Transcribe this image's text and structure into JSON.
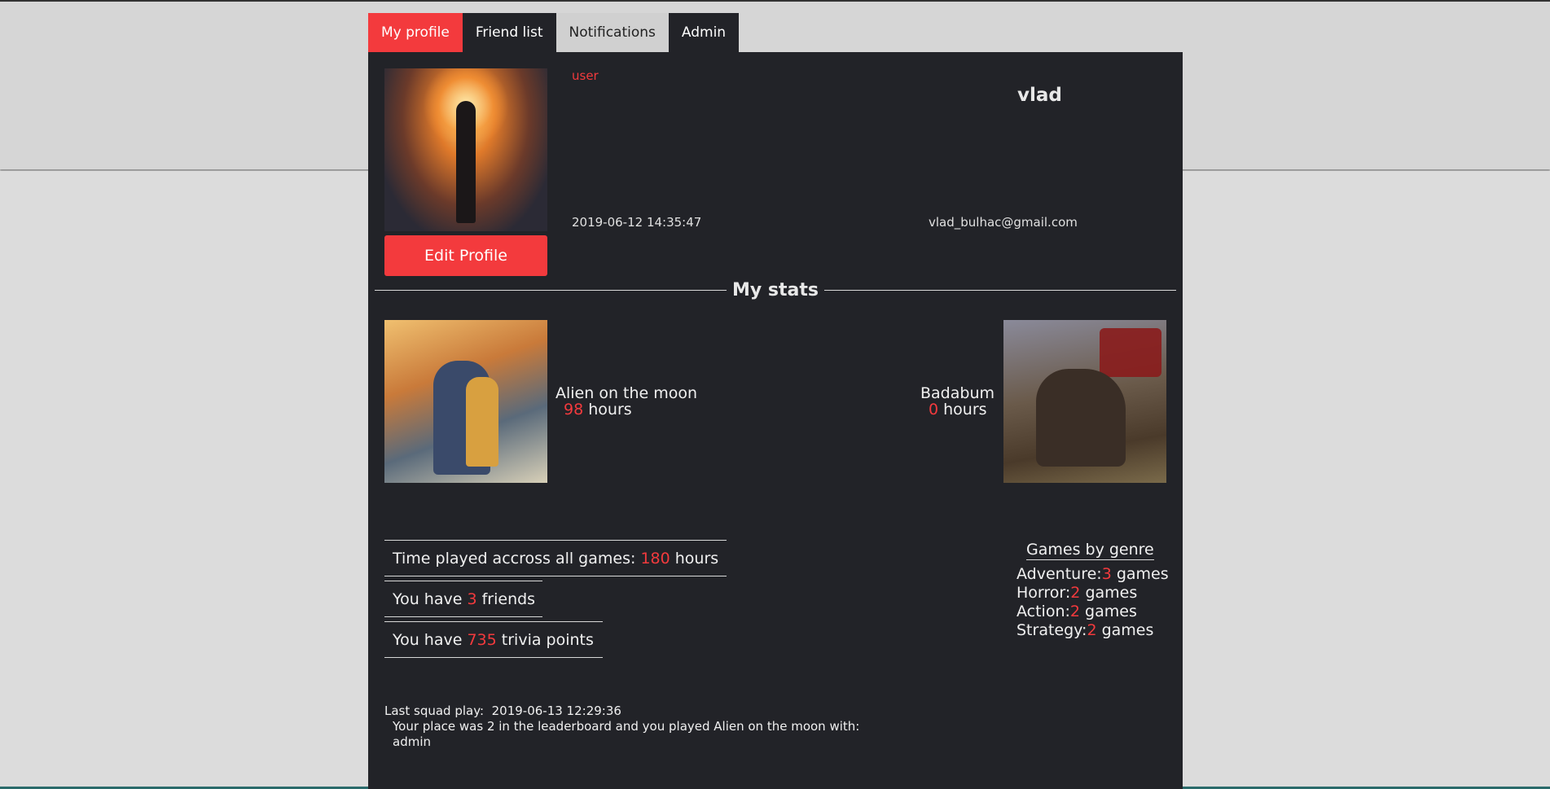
{
  "tabs": [
    {
      "label": "My profile"
    },
    {
      "label": "Friend list"
    },
    {
      "label": "Notifications"
    },
    {
      "label": "Admin"
    }
  ],
  "profile": {
    "role": "user",
    "username": "vlad",
    "joined": "2019-06-12 14:35:47",
    "email": "vlad_bulhac@gmail.com",
    "edit_button": "Edit Profile"
  },
  "stats": {
    "title": "My stats",
    "games": [
      {
        "name": "Alien on the moon",
        "hours": "98",
        "hours_label": "hours"
      },
      {
        "name": "Badabum",
        "hours": "0",
        "hours_label": "hours"
      }
    ],
    "time_played": {
      "prefix": "Time played accross all games:",
      "value": "180",
      "suffix": "hours"
    },
    "friends": {
      "prefix": "You have",
      "value": "3",
      "suffix": "friends"
    },
    "trivia": {
      "prefix": "You have",
      "value": "735",
      "suffix": "trivia points"
    },
    "genres": {
      "title": "Games by genre",
      "items": [
        {
          "name": "Adventure:",
          "count": "3",
          "unit": "games"
        },
        {
          "name": "Horror:",
          "count": "2",
          "unit": "games"
        },
        {
          "name": "Action:",
          "count": "2",
          "unit": "games"
        },
        {
          "name": "Strategy:",
          "count": "2",
          "unit": "games"
        }
      ]
    }
  },
  "squad": {
    "label": "Last squad play:",
    "date": "2019-06-13 12:29:36",
    "line1": "Your place was 2 in the leaderboard and you played Alien on the moon with:",
    "line2": "admin"
  },
  "colors": {
    "accent": "#f33a3d",
    "panel": "#222328",
    "background": "#d9d9d9"
  }
}
